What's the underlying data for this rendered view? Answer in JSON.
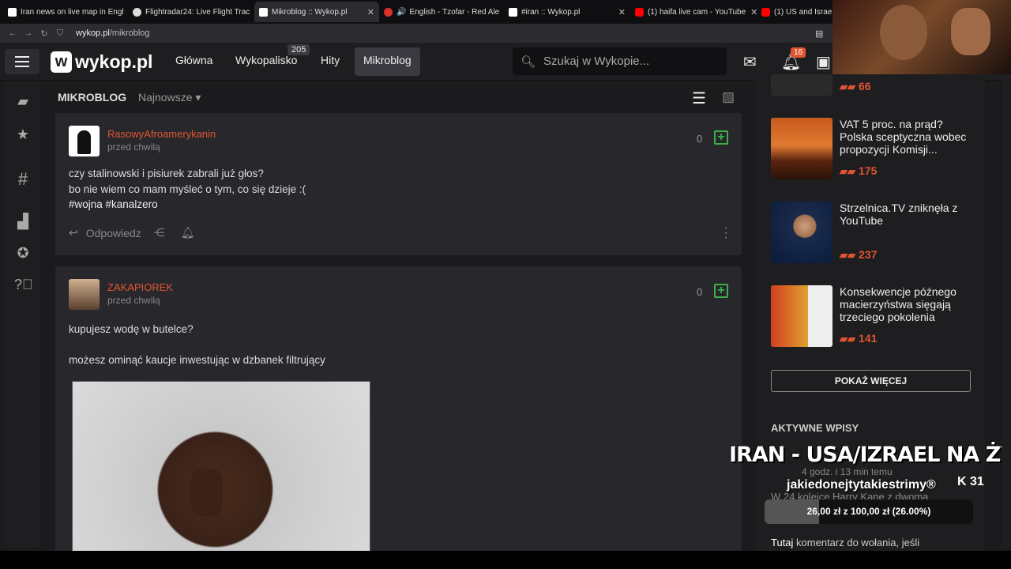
{
  "browser": {
    "tabs": [
      {
        "label": "Iran news on live map in Engl",
        "color": "#ffffff"
      },
      {
        "label": "Flightradar24: Live Flight Trac",
        "color": "#dddddd"
      },
      {
        "label": "Mikroblog :: Wykop.pl",
        "color": "#ffffff",
        "active": true
      },
      {
        "label": "English - Tzofar - Red Ale",
        "color": "#e0302c"
      },
      {
        "label": "#iran :: Wykop.pl",
        "color": "#ffffff"
      },
      {
        "label": "(1) haifa live cam - YouTube",
        "color": "#ff0000"
      },
      {
        "label": "(1) US and Israel",
        "color": "#ff0000"
      }
    ],
    "url_domain": "wykop.pl",
    "url_path": "/mikroblog"
  },
  "header": {
    "logo": "wykop.pl",
    "nav": [
      "Główna",
      "Wykopalisko",
      "Hity",
      "Mikroblog"
    ],
    "wykopalisko_count": "205",
    "search_placeholder": "Szukaj w Wykopie...",
    "notifications_count": "16"
  },
  "main": {
    "title": "MIKROBLOG",
    "sort": "Najnowsze",
    "posts": [
      {
        "author": "RasowyAfroamerykanin",
        "time": "przed chwilą",
        "votes": "0",
        "lines": [
          "czy stalinowski i pisiurek zabrali już głos?",
          "bo nie wiem co mam myśleć o tym, co się dzieje :(",
          "#wojna #kanalzero"
        ],
        "reply": "Odpowiedz"
      },
      {
        "author": "ZAKAPIOREK",
        "time": "przed chwilą",
        "votes": "0",
        "lines": [
          "kupujesz wodę w butelce?",
          "",
          "możesz ominąć kaucje inwestując w dzbanek filtrujący"
        ]
      }
    ]
  },
  "right": {
    "top_score": "66",
    "news": [
      {
        "title": "VAT 5 proc. na prąd? Polska sceptyczna wobec propozycji Komisji...",
        "score": "175"
      },
      {
        "title": "Strzelnica.TV zniknęła z YouTube",
        "score": "237"
      },
      {
        "title": "Konsekwencje późnego macierzyństwa sięgają trzeciego pokolenia",
        "score": "141"
      }
    ],
    "show_more": "POKAŻ WIĘCEJ",
    "active_title": "AKTYWNE WPISY",
    "active_meta": "4 godz. i 13 min temu",
    "active_text": "W 24 kolejce Harry Kane z dwoma",
    "active_text2_bold": "Tutaj",
    "active_text2": "komentarz do wołania, jeśli"
  },
  "overlay": {
    "title": "IRAN - USA/IZRAEL NA ŻYWO",
    "channel": "jakiedonejtytakiestrimy®",
    "viewers": "31",
    "progress_text": "26,00 zł z 100,00 zł (26.00%)",
    "progress": 0.26
  },
  "colors": {
    "accent": "#e05431",
    "plus": "#3bb04a"
  }
}
